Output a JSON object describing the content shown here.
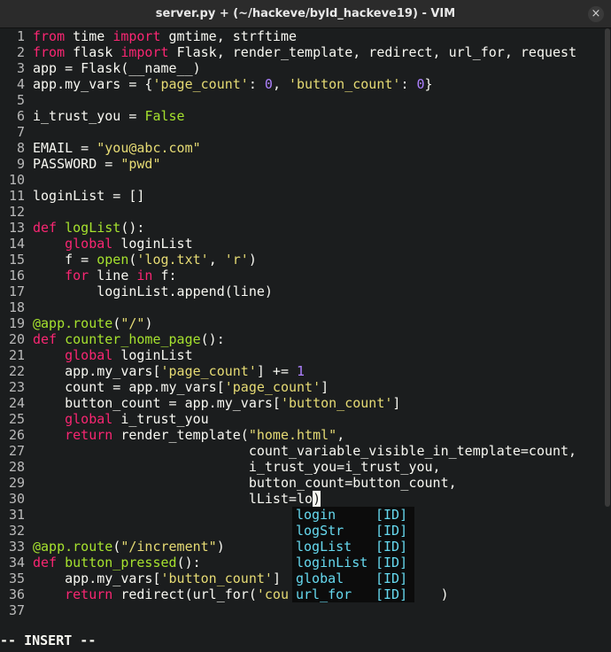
{
  "window": {
    "title": "server.py + (~/hackeve/byld_hackeve19) - VIM",
    "close_glyph": "×"
  },
  "status": {
    "mode": "-- INSERT --"
  },
  "theme": {
    "keyword": "#f92672",
    "function": "#a6e22e",
    "string": "#e6db74",
    "number": "#ae81ff",
    "text": "#f8f8f2",
    "popup_text": "#66d9ef",
    "background": "#1b1d1e"
  },
  "lines": [
    {
      "n": "1",
      "t": [
        [
          "kw",
          "from"
        ],
        [
          "",
          "time "
        ],
        [
          "kw",
          "import"
        ],
        [
          "",
          "gmtime, strftime"
        ]
      ]
    },
    {
      "n": "2",
      "t": [
        [
          "kw",
          "from"
        ],
        [
          "",
          "flask "
        ],
        [
          "kw",
          "import"
        ],
        [
          "",
          "Flask, render_template, redirect, url_for, request"
        ]
      ]
    },
    {
      "n": "3",
      "t": [
        [
          "",
          "app = Flask(__name__)"
        ]
      ]
    },
    {
      "n": "4",
      "t": [
        [
          "",
          "app.my_vars = {"
        ],
        [
          "str",
          "'page_count'"
        ],
        [
          "",
          ": "
        ],
        [
          "num",
          "0"
        ],
        [
          "",
          ", "
        ],
        [
          "str",
          "'button_count'"
        ],
        [
          "",
          ": "
        ],
        [
          "num",
          "0"
        ],
        [
          "",
          "}"
        ]
      ]
    },
    {
      "n": "5",
      "t": []
    },
    {
      "n": "6",
      "t": [
        [
          "",
          "i_trust_you = "
        ],
        [
          "fn",
          "False"
        ]
      ]
    },
    {
      "n": "7",
      "t": []
    },
    {
      "n": "8",
      "t": [
        [
          "",
          "EMAIL = "
        ],
        [
          "str",
          "\"you@abc.com\""
        ]
      ]
    },
    {
      "n": "9",
      "t": [
        [
          "",
          "PASSWORD = "
        ],
        [
          "str",
          "\"pwd\""
        ]
      ]
    },
    {
      "n": "10",
      "t": []
    },
    {
      "n": "11",
      "t": [
        [
          "",
          "loginList = []"
        ]
      ]
    },
    {
      "n": "12",
      "t": []
    },
    {
      "n": "13",
      "t": [
        [
          "kw",
          "def"
        ],
        [
          "",
          ""
        ],
        [
          "fn",
          "logList"
        ],
        [
          "",
          "():"
        ]
      ]
    },
    {
      "n": "14",
      "t": [
        [
          "",
          "    "
        ],
        [
          "kw",
          "global"
        ],
        [
          "",
          "loginList"
        ]
      ]
    },
    {
      "n": "15",
      "t": [
        [
          "",
          "    f = "
        ],
        [
          "fn",
          "open"
        ],
        [
          "",
          "("
        ],
        [
          "str",
          "'log.txt'"
        ],
        [
          "",
          ", "
        ],
        [
          "str",
          "'r'"
        ],
        [
          "",
          ")"
        ]
      ]
    },
    {
      "n": "16",
      "t": [
        [
          "",
          "    "
        ],
        [
          "kw",
          "for"
        ],
        [
          "",
          "line "
        ],
        [
          "kw",
          "in"
        ],
        [
          "",
          "f:"
        ]
      ]
    },
    {
      "n": "17",
      "t": [
        [
          "",
          "        loginList.append(line)"
        ]
      ]
    },
    {
      "n": "18",
      "t": []
    },
    {
      "n": "19",
      "t": [
        [
          "fn",
          "@app.route"
        ],
        [
          "",
          "("
        ],
        [
          "str",
          "\"/\""
        ],
        [
          "",
          ")"
        ]
      ]
    },
    {
      "n": "20",
      "t": [
        [
          "kw",
          "def"
        ],
        [
          "",
          ""
        ],
        [
          "fn",
          "counter_home_page"
        ],
        [
          "",
          "():"
        ]
      ]
    },
    {
      "n": "21",
      "t": [
        [
          "",
          "    "
        ],
        [
          "kw",
          "global"
        ],
        [
          "",
          "loginList"
        ]
      ]
    },
    {
      "n": "22",
      "t": [
        [
          "",
          "    app.my_vars["
        ],
        [
          "str",
          "'page_count'"
        ],
        [
          "",
          "] += "
        ],
        [
          "num",
          "1"
        ]
      ]
    },
    {
      "n": "23",
      "t": [
        [
          "",
          "    count = app.my_vars["
        ],
        [
          "str",
          "'page_count'"
        ],
        [
          "",
          "]"
        ]
      ]
    },
    {
      "n": "24",
      "t": [
        [
          "",
          "    button_count = app.my_vars["
        ],
        [
          "str",
          "'button_count'"
        ],
        [
          "",
          "]"
        ]
      ]
    },
    {
      "n": "25",
      "t": [
        [
          "",
          "    "
        ],
        [
          "kw",
          "global"
        ],
        [
          "",
          "i_trust_you"
        ]
      ]
    },
    {
      "n": "26",
      "t": [
        [
          "",
          "    "
        ],
        [
          "kw",
          "return"
        ],
        [
          "",
          "render_template("
        ],
        [
          "str",
          "\"home.html\""
        ],
        [
          "",
          ","
        ]
      ]
    },
    {
      "n": "27",
      "t": [
        [
          "",
          "                           count_variable_visible_in_template=count,"
        ]
      ]
    },
    {
      "n": "28",
      "t": [
        [
          "",
          "                           i_trust_you=i_trust_you,"
        ]
      ]
    },
    {
      "n": "29",
      "t": [
        [
          "",
          "                           button_count=button_count,"
        ]
      ]
    },
    {
      "n": "30",
      "t": [
        [
          "",
          "                           lList=lo"
        ],
        [
          "cursor",
          ")"
        ]
      ]
    },
    {
      "n": "31",
      "t": []
    },
    {
      "n": "32",
      "t": []
    },
    {
      "n": "33",
      "t": [
        [
          "fn",
          "@app.route"
        ],
        [
          "",
          "("
        ],
        [
          "str",
          "\"/increment\""
        ],
        [
          "",
          ")"
        ]
      ]
    },
    {
      "n": "34",
      "t": [
        [
          "kw",
          "def"
        ],
        [
          "",
          ""
        ],
        [
          "fn",
          "button_pressed"
        ],
        [
          "",
          "():"
        ]
      ]
    },
    {
      "n": "35",
      "t": [
        [
          "",
          "    app.my_vars["
        ],
        [
          "str",
          "'button_count'"
        ],
        [
          "",
          "]"
        ]
      ]
    },
    {
      "n": "36",
      "t": [
        [
          "",
          "    "
        ],
        [
          "kw",
          "return"
        ],
        [
          "",
          "redirect(url_for("
        ],
        [
          "str",
          "'cou"
        ],
        [
          "",
          "                   )"
        ]
      ]
    },
    {
      "n": "37",
      "t": []
    }
  ],
  "completion": [
    {
      "name": "login",
      "kind": "[ID]"
    },
    {
      "name": "logStr",
      "kind": "[ID]"
    },
    {
      "name": "logList",
      "kind": "[ID]"
    },
    {
      "name": "loginList",
      "kind": "[ID]"
    },
    {
      "name": "global",
      "kind": "[ID]"
    },
    {
      "name": "url_for",
      "kind": "[ID]"
    }
  ]
}
